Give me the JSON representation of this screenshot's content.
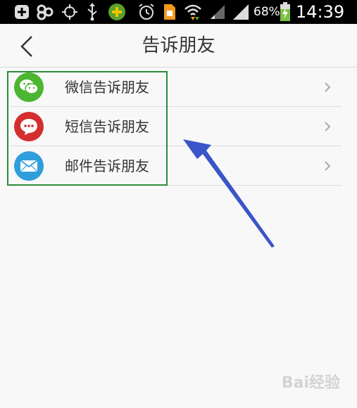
{
  "status_bar": {
    "battery_percent": "68%",
    "time": "14:39",
    "icons": [
      "add-icon",
      "gallery-icon",
      "crosshair-icon",
      "usb-icon",
      "game-icon",
      "alarm-icon",
      "sim-icon",
      "wifi-icon",
      "signal-weak-icon",
      "signal-icon",
      "battery-charging-icon"
    ]
  },
  "header": {
    "title": "告诉朋友",
    "back_icon": "chevron-left-icon"
  },
  "share_options": [
    {
      "label": "微信告诉朋友",
      "icon": "wechat-icon",
      "color": "#4cb531"
    },
    {
      "label": "短信告诉朋友",
      "icon": "sms-icon",
      "color": "#d42e2e"
    },
    {
      "label": "邮件告诉朋友",
      "icon": "mail-icon",
      "color": "#2f9edb"
    }
  ],
  "annotation": {
    "box_color": "#2e8b3a",
    "arrow_color": "#3a55c8"
  },
  "watermark": "Bai经验"
}
